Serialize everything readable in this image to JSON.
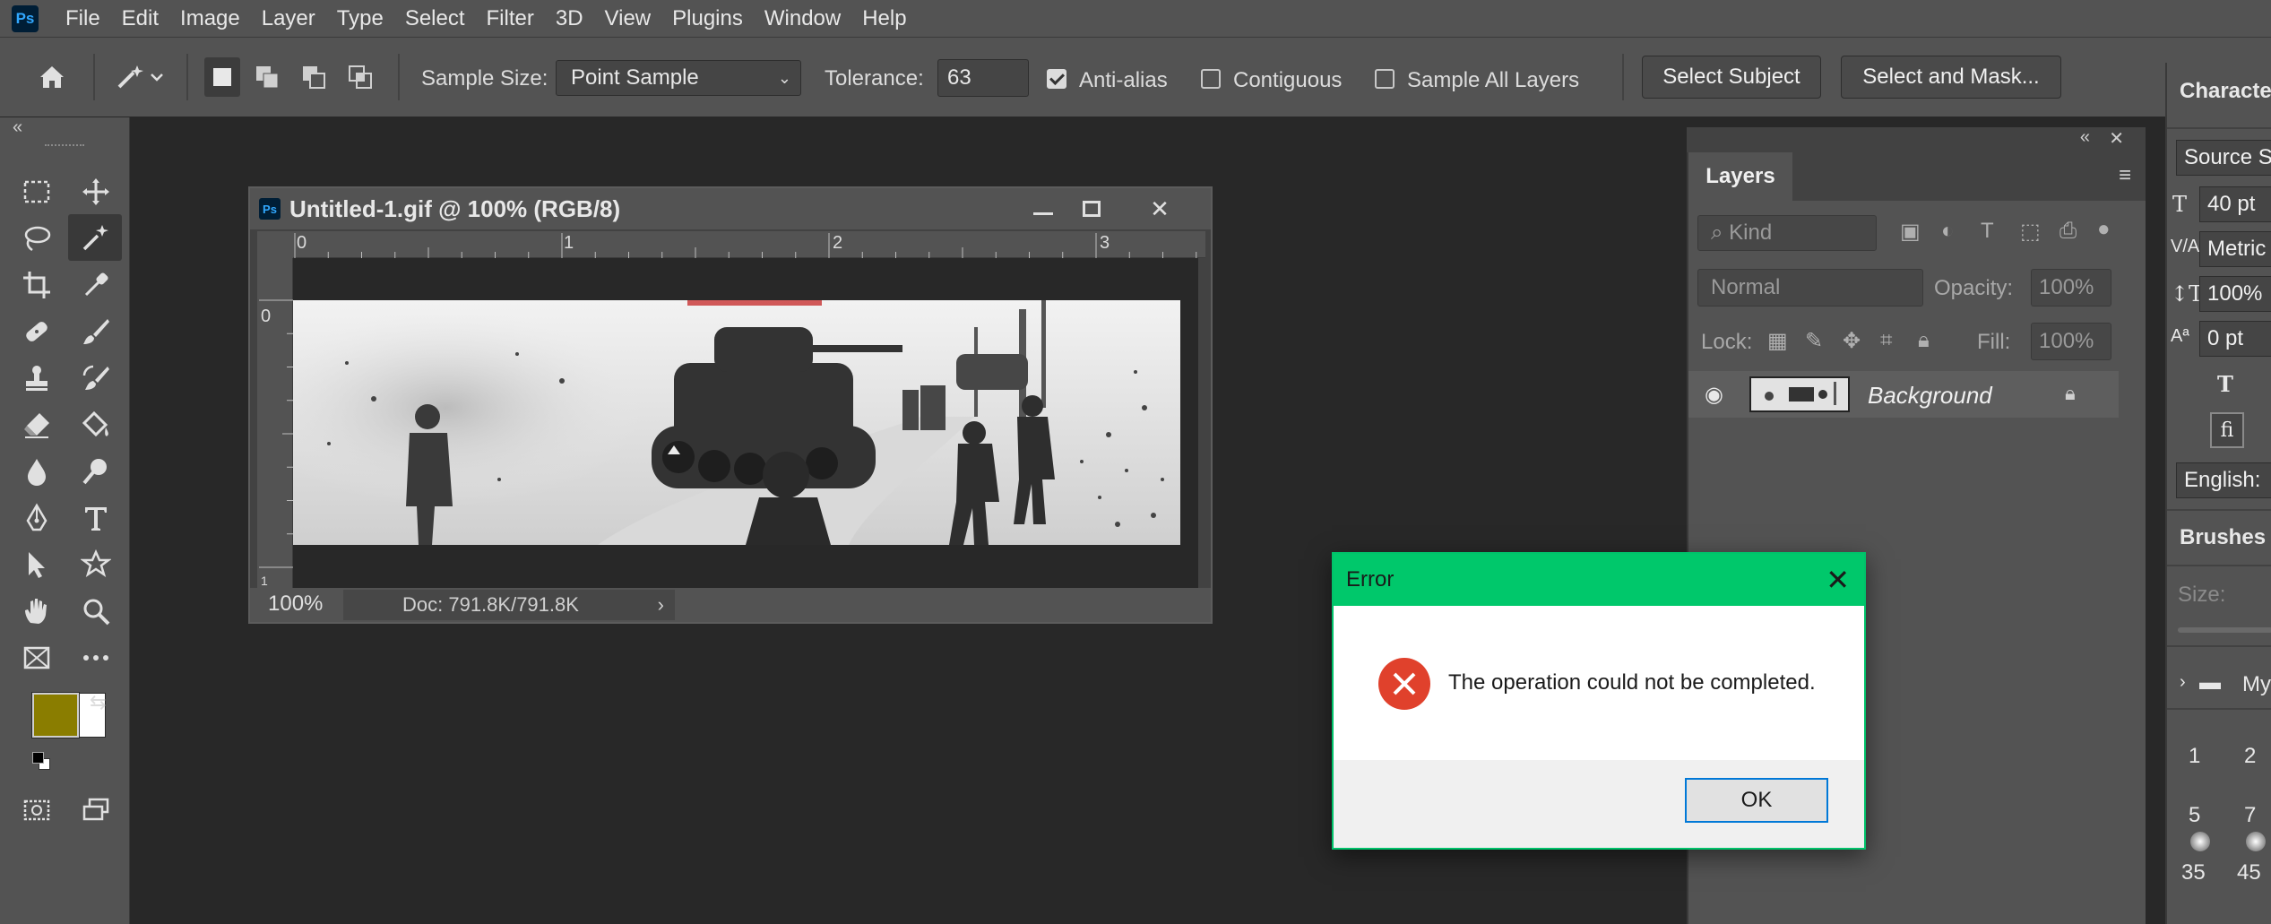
{
  "app": {
    "logo": "Ps"
  },
  "menu": [
    "File",
    "Edit",
    "Image",
    "Layer",
    "Type",
    "Select",
    "Filter",
    "3D",
    "View",
    "Plugins",
    "Window",
    "Help"
  ],
  "options": {
    "sample_size_label": "Sample Size:",
    "sample_size_value": "Point Sample",
    "tolerance_label": "Tolerance:",
    "tolerance_value": "63",
    "anti_alias_label": "Anti-alias",
    "anti_alias_checked": true,
    "contiguous_label": "Contiguous",
    "contiguous_checked": false,
    "sample_all_layers_label": "Sample All Layers",
    "sample_all_layers_checked": false,
    "select_subject_label": "Select Subject",
    "select_and_mask_label": "Select and Mask..."
  },
  "toolbar": {
    "collapse_icon": "«",
    "foreground_color": "#8a7d00",
    "background_color": "#ffffff"
  },
  "document": {
    "logo": "Ps",
    "title": "Untitled-1.gif @ 100% (RGB/8)",
    "ruler_h": [
      "0",
      "1",
      "2",
      "3"
    ],
    "ruler_v": [
      "0",
      "1"
    ],
    "zoom": "100%",
    "doc_size": "Doc: 791.8K/791.8K"
  },
  "layers": {
    "tab_label": "Layers",
    "kind_label": "Kind",
    "blend_mode": "Normal",
    "opacity_label": "Opacity:",
    "opacity_value": "100%",
    "lock_label": "Lock:",
    "fill_label": "Fill:",
    "fill_value": "100%",
    "layer_name": "Background"
  },
  "character": {
    "title": "Characte",
    "font": "Source Sa",
    "size": "40 pt",
    "kerning": "Metric",
    "scale": "100%",
    "baseline": "0 pt",
    "language": "English:"
  },
  "brushes": {
    "title": "Brushes",
    "size_label": "Size:",
    "folder_label": "My",
    "presets": [
      "1",
      "2",
      "5",
      "7",
      "35",
      "45"
    ]
  },
  "dialog": {
    "title": "Error",
    "message": "The operation could not be completed.",
    "ok_label": "OK",
    "title_color": "#00c86b",
    "icon_color": "#e0412c"
  }
}
